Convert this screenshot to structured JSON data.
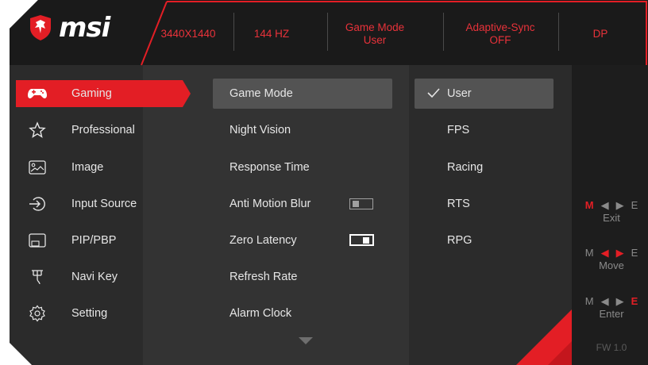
{
  "brand": {
    "logo_text": "msi",
    "accent": "#e31e25"
  },
  "status_bar": {
    "resolution": "3440X1440",
    "refresh": "144 HZ",
    "game_mode": {
      "title": "Game Mode",
      "value": "User"
    },
    "adaptive_sync": {
      "title": "Adaptive-Sync",
      "value": "OFF"
    },
    "input": "DP"
  },
  "sidebar": {
    "items": [
      {
        "label": "Gaming",
        "icon": "gamepad-icon",
        "active": true
      },
      {
        "label": "Professional",
        "icon": "star-icon"
      },
      {
        "label": "Image",
        "icon": "image-icon"
      },
      {
        "label": "Input Source",
        "icon": "input-source-icon"
      },
      {
        "label": "PIP/PBP",
        "icon": "pip-icon"
      },
      {
        "label": "Navi Key",
        "icon": "navi-key-icon"
      },
      {
        "label": "Setting",
        "icon": "gear-icon"
      }
    ]
  },
  "submenu": {
    "items": [
      {
        "label": "Game Mode",
        "selected": true
      },
      {
        "label": "Night Vision"
      },
      {
        "label": "Response Time"
      },
      {
        "label": "Anti Motion Blur",
        "toggle": "off"
      },
      {
        "label": "Zero Latency",
        "toggle": "on"
      },
      {
        "label": "Refresh Rate"
      },
      {
        "label": "Alarm Clock"
      }
    ],
    "more_icon": "scroll-down-arrow-icon"
  },
  "options": {
    "items": [
      {
        "label": "User",
        "checked": true
      },
      {
        "label": "FPS"
      },
      {
        "label": "Racing"
      },
      {
        "label": "RTS"
      },
      {
        "label": "RPG"
      }
    ]
  },
  "key_hints": [
    {
      "keys": [
        "M",
        "◀",
        "▶",
        "E"
      ],
      "caption": "Exit"
    },
    {
      "keys": [
        "M",
        "◀",
        "▶",
        "E"
      ],
      "caption": "Move"
    },
    {
      "keys": [
        "M",
        "◀",
        "▶",
        "E"
      ],
      "caption": "Enter"
    }
  ],
  "firmware": "FW 1.0"
}
